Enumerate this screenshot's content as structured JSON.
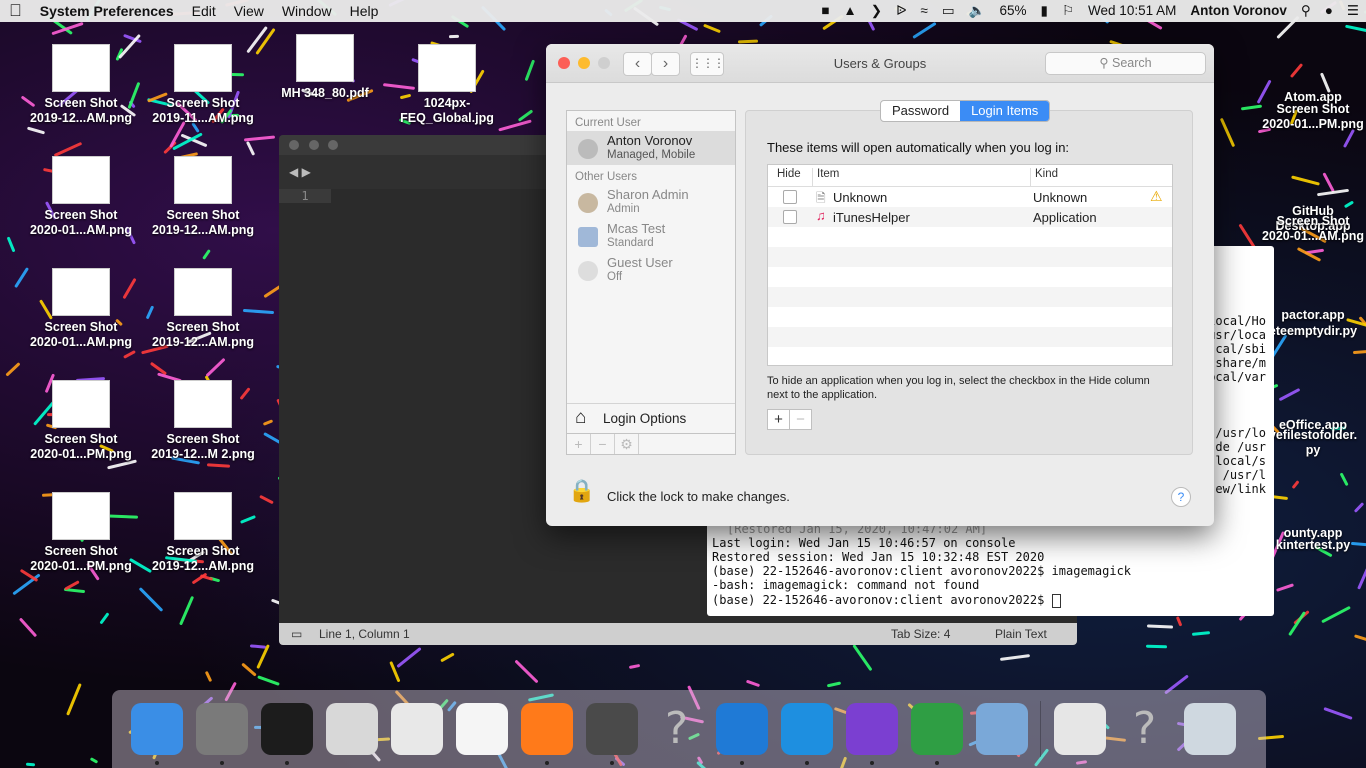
{
  "menubar": {
    "app_name": "System Preferences",
    "menus": [
      "Edit",
      "View",
      "Window",
      "Help"
    ],
    "battery": "65%",
    "clock": "Wed 10:51 AM",
    "user": "Anton Voronov"
  },
  "desktop_icons": [
    {
      "name": "Screen Shot\n2019-12...AM.png"
    },
    {
      "name": "Screen Shot\n2019-11...AM.png"
    },
    {
      "name": "MH 348_80.pdf"
    },
    {
      "name": "1024px-\nFEQ_Global.jpg"
    },
    {
      "name": "Screen Shot\n2020-01...AM.png"
    },
    {
      "name": "Screen Shot\n2019-12...AM.png"
    },
    {
      "name": "Screen Shot\n2020-01...AM.png"
    },
    {
      "name": "Screen Shot\n2019-12...AM.png"
    },
    {
      "name": "Screen Shot\n2020-01...PM.png"
    },
    {
      "name": "Screen Shot\n2019-12...M 2.png"
    },
    {
      "name": "Screen Shot\n2020-01...PM.png"
    },
    {
      "name": "Screen Shot\n2019-12...AM.png"
    },
    {
      "name": "Atom.app"
    },
    {
      "name": "Screen Shot\n2020-01...PM.png"
    },
    {
      "name": "GitHub\nDesktop.app"
    },
    {
      "name": "Screen Shot\n2020-01...AM.png"
    },
    {
      "name": "pactor.app"
    },
    {
      "name": "eteemptydir.py"
    },
    {
      "name": "eOffice.app"
    },
    {
      "name": "vefilestofolder.\npy"
    },
    {
      "name": "ounty.app"
    },
    {
      "name": "kintertest.py"
    }
  ],
  "editor": {
    "line_number": "1",
    "status_position": "Line 1, Column 1",
    "tab_size": "Tab Size: 4",
    "syntax": "Plain Text"
  },
  "terminal": {
    "lines": [
      "local/Ho",
      "usr/loca",
      "cal/sbi",
      "share/m",
      "ocal/var",
      "/usr/lo",
      "de /usr",
      "local/s",
      " /usr/l",
      "ew/link"
    ],
    "restored_banner": "[Restored Jan 15, 2020, 10:47:02 AM]",
    "output": [
      "Last login: Wed Jan 15 10:46:57 on console",
      "Restored session: Wed Jan 15 10:32:48 EST 2020",
      "(base) 22-152646-avoronov:client avoronov2022$ imagemagick",
      "-bash: imagemagick: command not found",
      "(base) 22-152646-avoronov:client avoronov2022$ "
    ]
  },
  "prefs": {
    "title": "Users & Groups",
    "search_placeholder": "Search",
    "current_user_header": "Current User",
    "current_user": {
      "name": "Anton Voronov",
      "status": "Managed, Mobile"
    },
    "other_users_header": "Other Users",
    "other_users": [
      {
        "name": "Sharon Admin",
        "status": "Admin"
      },
      {
        "name": "Mcas Test",
        "status": "Standard"
      },
      {
        "name": "Guest User",
        "status": "Off"
      }
    ],
    "login_options": "Login Options",
    "tabs": [
      "Password",
      "Login Items"
    ],
    "active_tab": "Login Items",
    "intro": "These items will open automatically when you log in:",
    "columns": [
      "Hide",
      "Item",
      "Kind"
    ],
    "items": [
      {
        "name": "Unknown",
        "kind": "Unknown",
        "warning": true
      },
      {
        "name": "iTunesHelper",
        "kind": "Application",
        "warning": false
      }
    ],
    "hint": "To hide an application when you log in, select the checkbox in the Hide column next to the application.",
    "lock_text": "Click the lock to make changes.",
    "help": "?"
  },
  "dock": {
    "apps": [
      "Finder",
      "System Preferences",
      "Terminal",
      "Script Editor",
      "TextEdit",
      "Notes",
      "Firefox",
      "Sublime Text",
      "Unknown App",
      "VNC Viewer",
      "Visual Studio Code",
      "GitHub Desktop",
      "Chrome",
      "Preview",
      "MP3",
      "Unknown App",
      "Trash"
    ]
  }
}
